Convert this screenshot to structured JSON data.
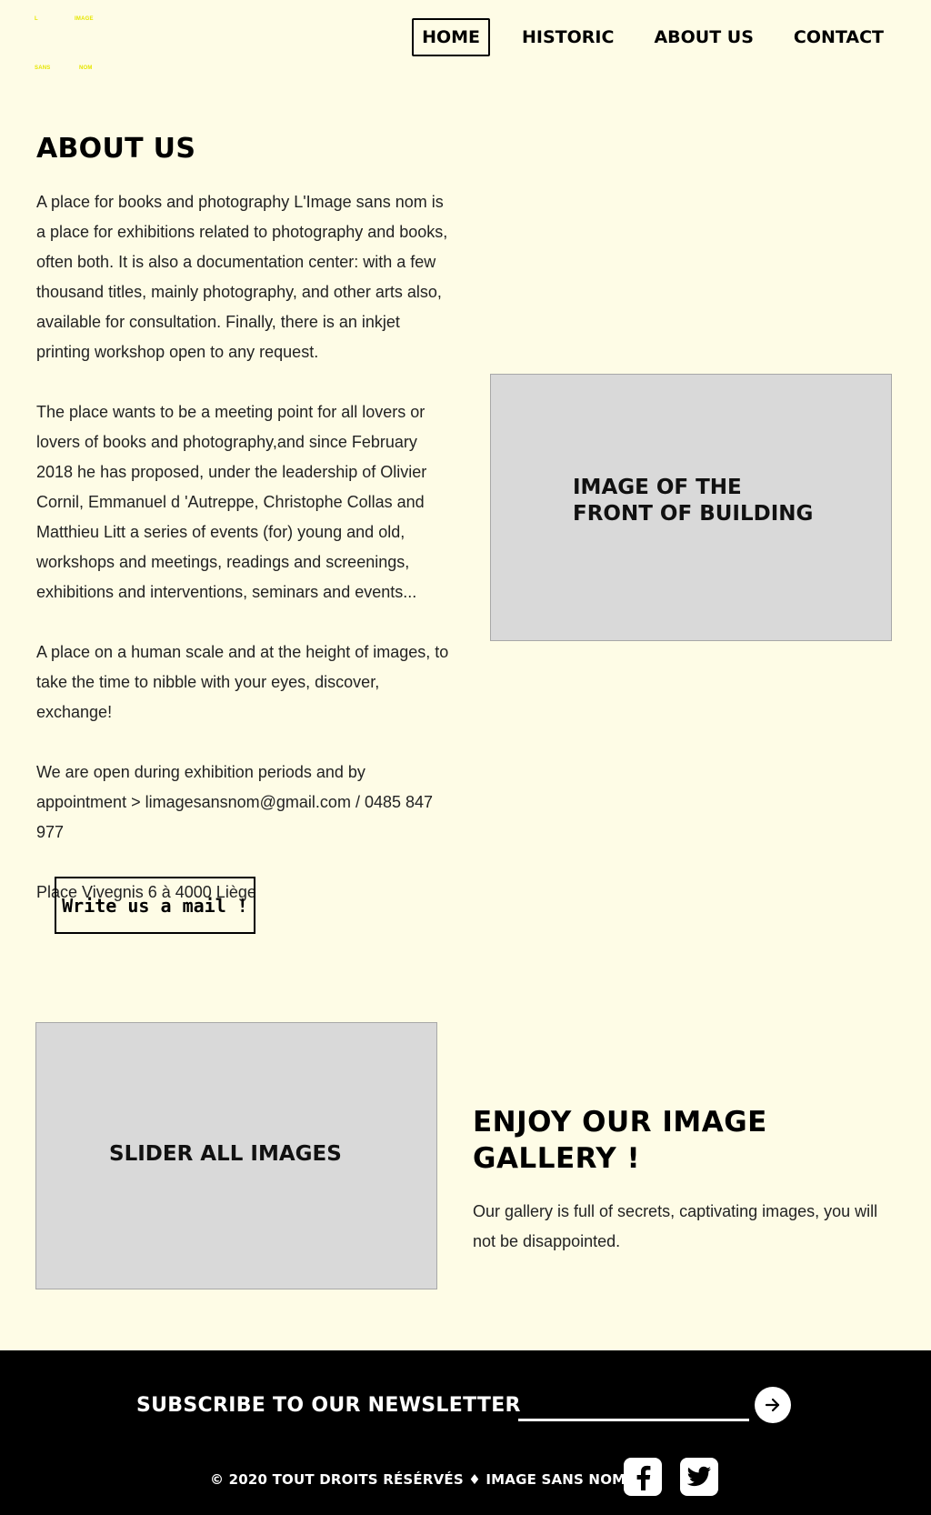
{
  "logo": {
    "words": [
      "L",
      "IMAGE",
      "SANS",
      "NOM"
    ]
  },
  "nav": {
    "items": [
      "HOME",
      "HISTORIC",
      "ABOUT US",
      "CONTACT"
    ],
    "active": "HOME"
  },
  "about": {
    "title": "ABOUT US",
    "paragraphs": [
      " A place for books and photography L'Image sans nom is a place for exhibitions related to photography and books, often both. It is also a documentation center: with a few thousand titles, mainly photography, and other arts also, available for consultation. Finally, there is an inkjet printing workshop open to any request.",
      "The place wants to be a meeting point for all lovers or lovers of books and photography,and since February 2018 he has proposed, under the leadership of Olivier Cornil, Emmanuel d 'Autreppe, Christophe Collas and Matthieu Litt a series of events (for) young and old, workshops and meetings, readings and screenings, exhibitions and interventions, seminars and events...",
      "A place on a human scale and at the height of images, to take the time to nibble with your eyes, discover, exchange!",
      "We are open during exhibition periods and by appointment > limagesansnom@gmail.com / 0485 847 977",
      "Place Vivegnis 6 à 4000 Liège"
    ],
    "button_label": "Write us a mail !"
  },
  "building_image": {
    "label": "IMAGE OF THE FRONT OF BUILDING"
  },
  "slider": {
    "label": "SLIDER  ALL IMAGES"
  },
  "gallery": {
    "title": "ENJOY OUR IMAGE GALLERY !",
    "text": "Our gallery is full of secrets, captivating images, you will not be disappointed."
  },
  "footer": {
    "newsletter_label": "SUBSCRIBE TO OUR NEWSLETTER",
    "newsletter_value": "",
    "copyright": "© 2020 TOUT DROITS RÉSÉRVÉS ♦ IMAGE SANS NOM",
    "social": [
      "facebook-icon",
      "twitter-icon"
    ]
  },
  "colors": {
    "background": "#fefce6",
    "logo": "#e6e600",
    "placeholder": "#d9d9d9",
    "footer": "#000000"
  }
}
